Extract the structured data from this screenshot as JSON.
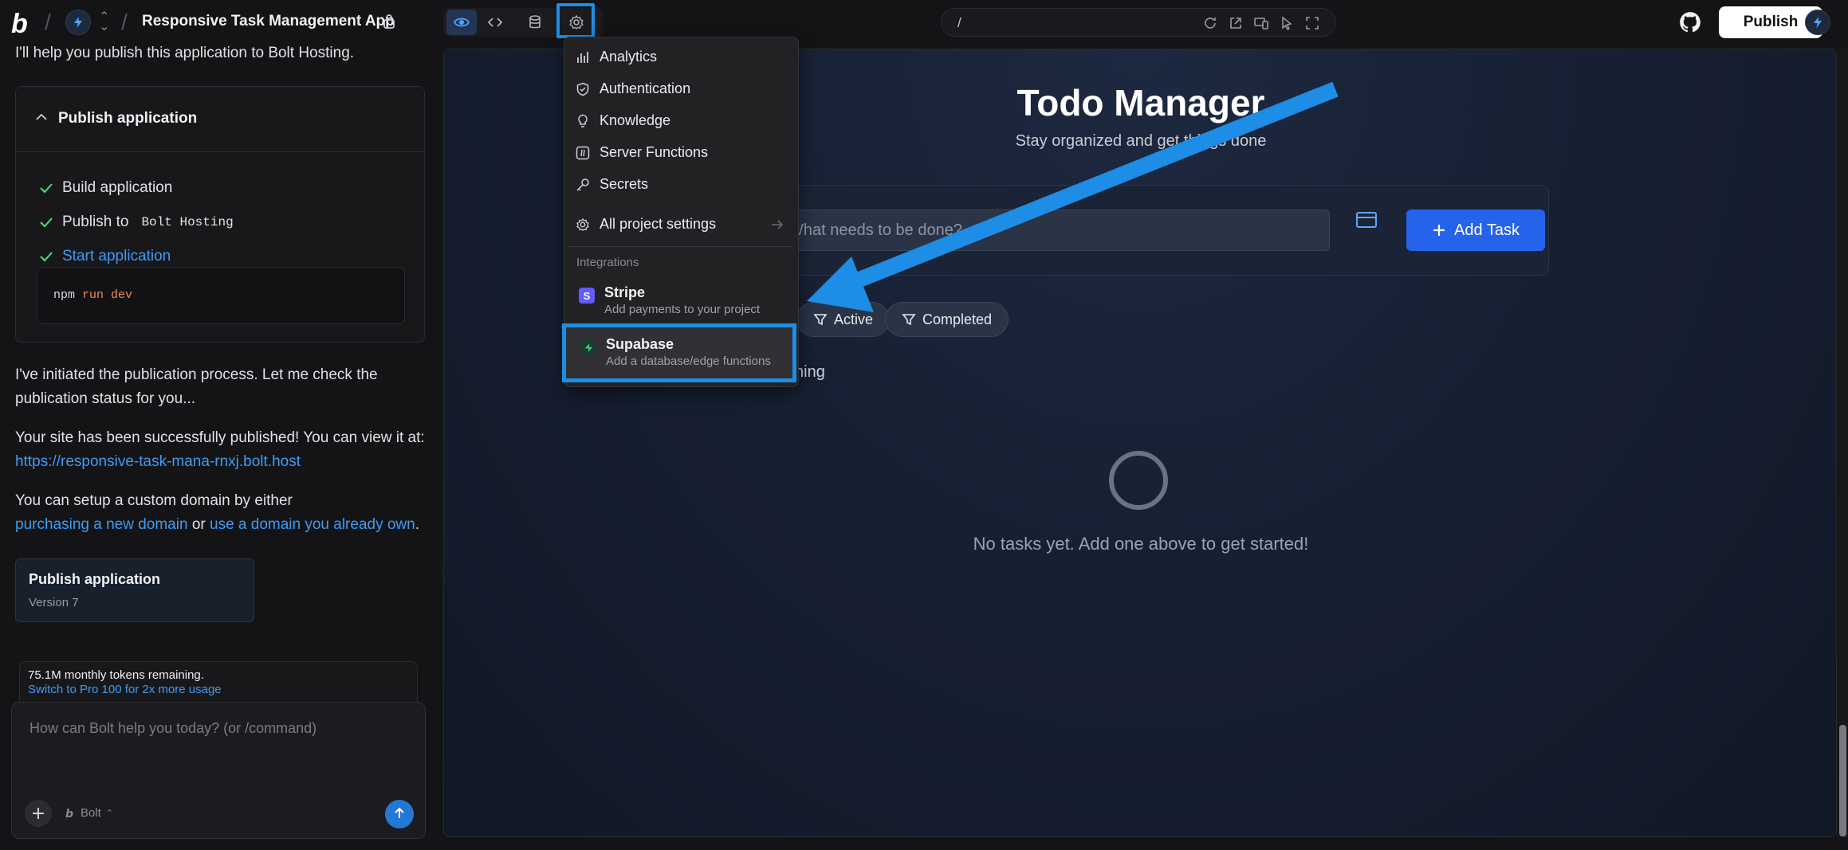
{
  "topbar": {
    "project_title": "Responsive Task Management App",
    "url_path": "/",
    "publish_label": "Publish"
  },
  "sidebar": {
    "intro": "I'll help you publish this application to Bolt Hosting.",
    "card": {
      "title": "Publish application",
      "steps": [
        {
          "label": "Build application"
        },
        {
          "label": "Publish to",
          "target": "Bolt Hosting"
        },
        {
          "label": "Start application"
        }
      ],
      "code": {
        "cmd": "npm",
        "args": "run dev"
      }
    },
    "paragraphs": {
      "p1": "I've initiated the publication process. Let me check the publication status for you...",
      "p2": "Your site has been successfully published! You can view it at:",
      "p2_link": "https://responsive-task-mana-rnxj.bolt.host",
      "p3": "You can setup a custom domain by either",
      "p3_link1": "purchasing a new domain",
      "p3_or": "or",
      "p3_link2": "use a domain you already own",
      "p3_end": "."
    },
    "publish_card": {
      "title": "Publish application",
      "version": "Version 7"
    },
    "tokens": {
      "remaining": "75.1M monthly tokens remaining.",
      "upgrade": "Switch to Pro 100 for 2x more usage"
    },
    "chat": {
      "placeholder": "How can Bolt help you today? (or /command)",
      "model": "Bolt"
    }
  },
  "preview": {
    "title": "Todo Manager",
    "subtitle": "Stay organized and get things done",
    "input_placeholder": "What needs to be done?",
    "add_label": "Add Task",
    "filters": [
      {
        "label": "Active"
      },
      {
        "label": "Completed"
      }
    ],
    "remaining_fragment": "ning",
    "empty_message": "No tasks yet. Add one above to get started!"
  },
  "menu": {
    "items": [
      {
        "label": "Analytics",
        "icon": "bar-chart-icon"
      },
      {
        "label": "Authentication",
        "icon": "shield-icon"
      },
      {
        "label": "Knowledge",
        "icon": "lightbulb-icon"
      },
      {
        "label": "Server Functions",
        "icon": "function-icon"
      },
      {
        "label": "Secrets",
        "icon": "key-icon"
      }
    ],
    "all_settings": "All project settings",
    "section": "Integrations",
    "integrations": [
      {
        "name": "Stripe",
        "desc": "Add payments to your project",
        "color": "#635bff"
      },
      {
        "name": "Supabase",
        "desc": "Add a database/edge functions",
        "color": "#3ecf8e"
      }
    ]
  },
  "colors": {
    "accent": "#1d8de6",
    "primary_button": "#2563eb",
    "link": "#3b9cf6",
    "check": "#4ade80"
  }
}
